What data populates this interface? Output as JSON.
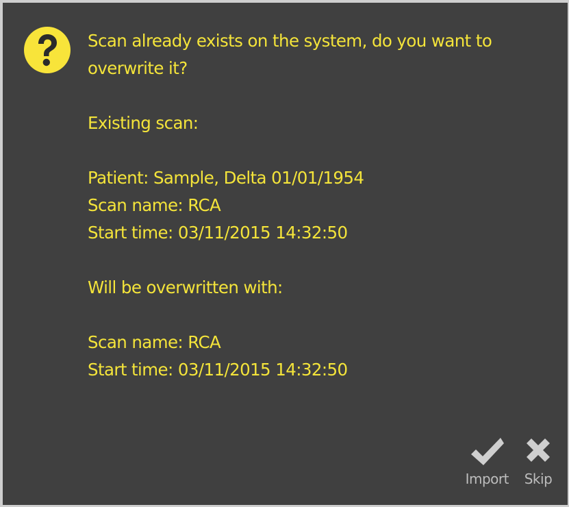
{
  "dialog": {
    "icon": "question-icon",
    "accent_color": "#f8e43a",
    "background_color": "#404040",
    "message": {
      "title_line1": "Scan already exists on the system, do you want to",
      "title_line2": "overwrite it?",
      "existing_heading": "Existing scan:",
      "existing_patient": "Patient: Sample, Delta  01/01/1954",
      "existing_scan_name": "Scan name: RCA",
      "existing_start_time": "Start time: 03/11/2015 14:32:50",
      "new_heading": "Will be overwritten with:",
      "new_scan_name": "Scan name: RCA",
      "new_start_time": "Start time: 03/11/2015 14:32:50"
    },
    "actions": {
      "import": {
        "label": "Import",
        "icon": "checkmark-icon"
      },
      "skip": {
        "label": "Skip",
        "icon": "close-icon"
      }
    }
  }
}
